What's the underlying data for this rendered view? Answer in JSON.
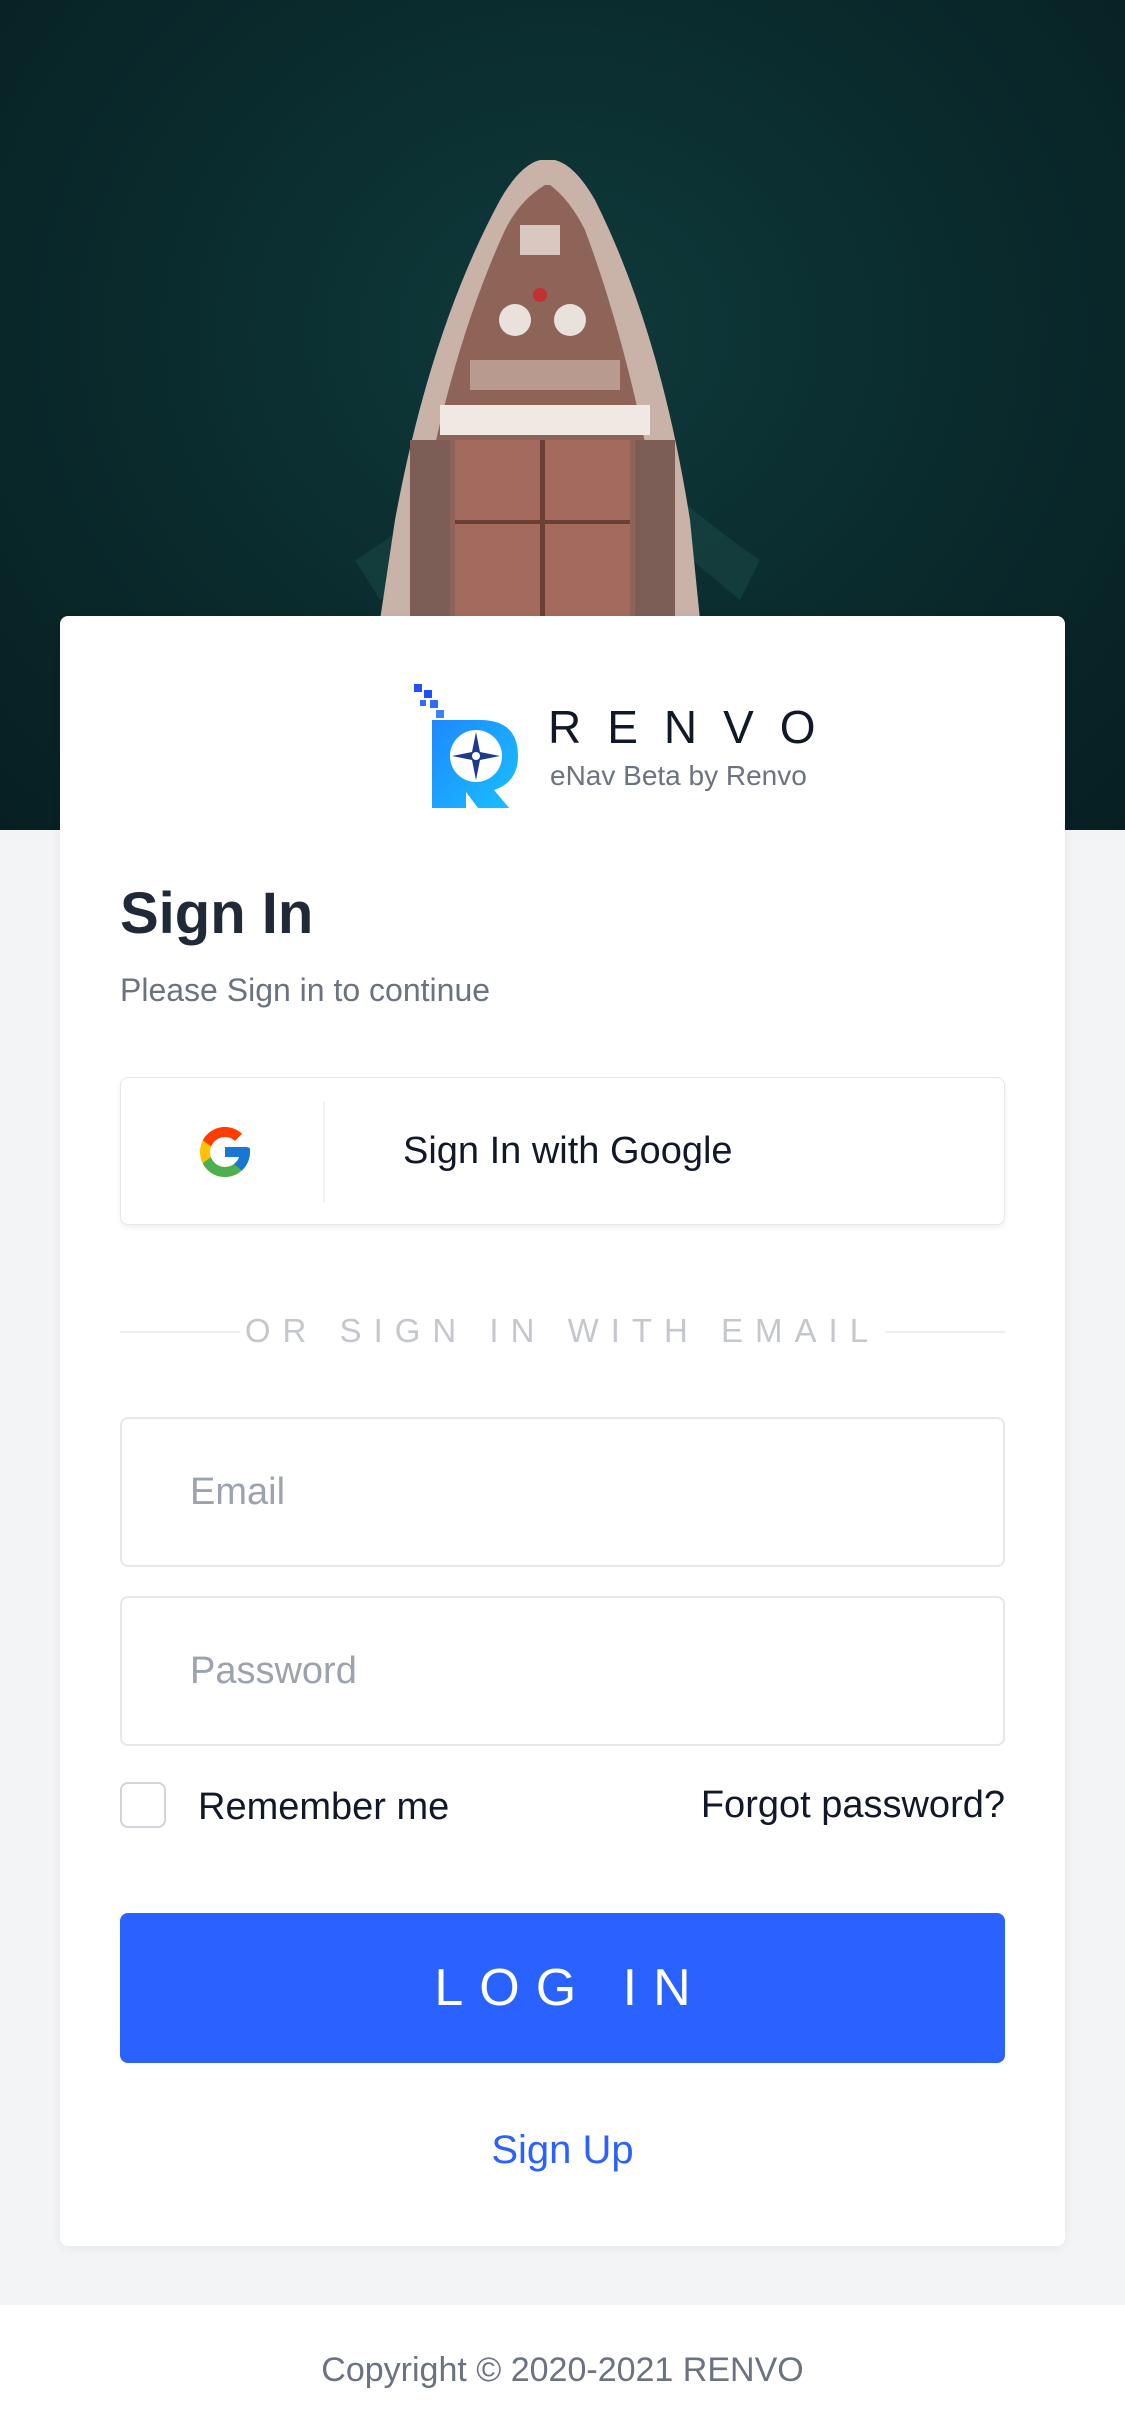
{
  "brand": {
    "name": "RENVO",
    "tagline": "eNav Beta by Renvo"
  },
  "signin": {
    "title": "Sign In",
    "subtitle": "Please Sign in to continue",
    "google_label": "Sign In with Google",
    "divider_text": "OR SIGN IN WITH EMAIL",
    "email_placeholder": "Email",
    "password_placeholder": "Password",
    "remember_label": "Remember me",
    "forgot_label": "Forgot password?",
    "login_label": "LOG IN",
    "signup_label": "Sign Up"
  },
  "footer": {
    "copyright": "Copyright © 2020-2021 RENVO"
  },
  "colors": {
    "accent": "#2962ff",
    "hero_water": "#0a2a2c",
    "page_bg": "#f3f4f6"
  }
}
